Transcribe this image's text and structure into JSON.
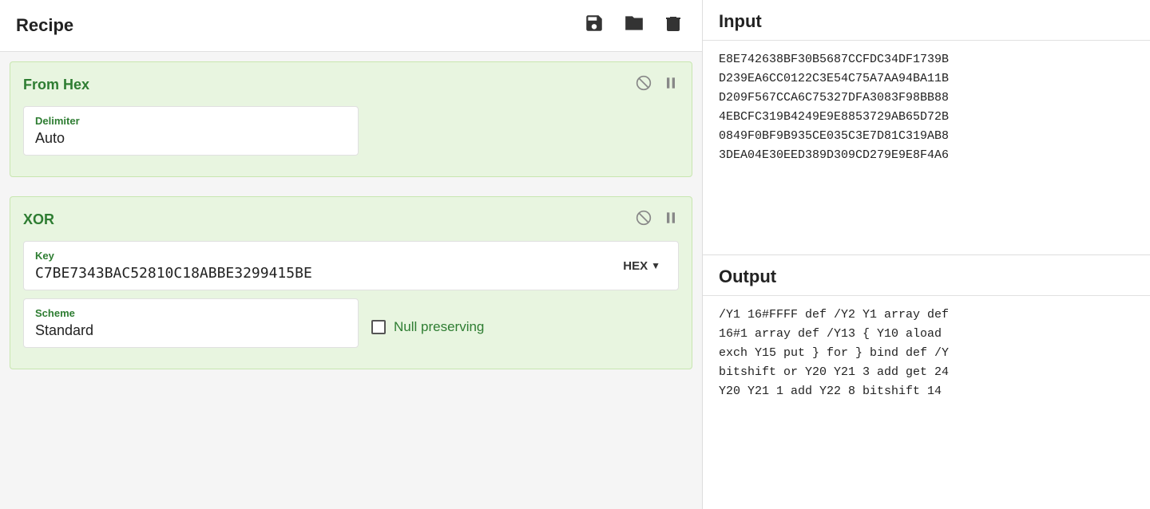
{
  "recipe": {
    "title": "Recipe",
    "toolbar": {
      "save_icon": "💾",
      "folder_icon": "📁",
      "delete_icon": "🗑"
    }
  },
  "from_hex": {
    "name": "From Hex",
    "delimiter_label": "Delimiter",
    "delimiter_value": "Auto"
  },
  "xor": {
    "name": "XOR",
    "key_label": "Key",
    "key_value": "C7BE7343BAC52810C18ABBE3299415BE",
    "key_type": "HEX",
    "scheme_label": "Scheme",
    "scheme_value": "Standard",
    "null_preserving_label": "Null preserving"
  },
  "input": {
    "title": "Input",
    "content": "E8E742638BF30B5687CCFDC34DF1739B\nD239EA6CC0122C3E54C75A7AA94BA11B\nD209F567CCA6C75327DFA3083F98BB88\n4EBCFC319B4249E9E8853729AB65D72B\n0849F0BF9B935CE035C3E7D81C319AB8\n3DEA04E30EED389D309CD279E9E8F4A6"
  },
  "output": {
    "title": "Output",
    "content": "/Y1 16#FFFF def /Y2 Y1 array def\n16#1 array def /Y13 { Y10 aload\nexch Y15 put } for } bind def /Y\nbitshift or Y20 Y21 3 add get 24\nY20 Y21 1 add Y22 8 bitshift 14"
  }
}
